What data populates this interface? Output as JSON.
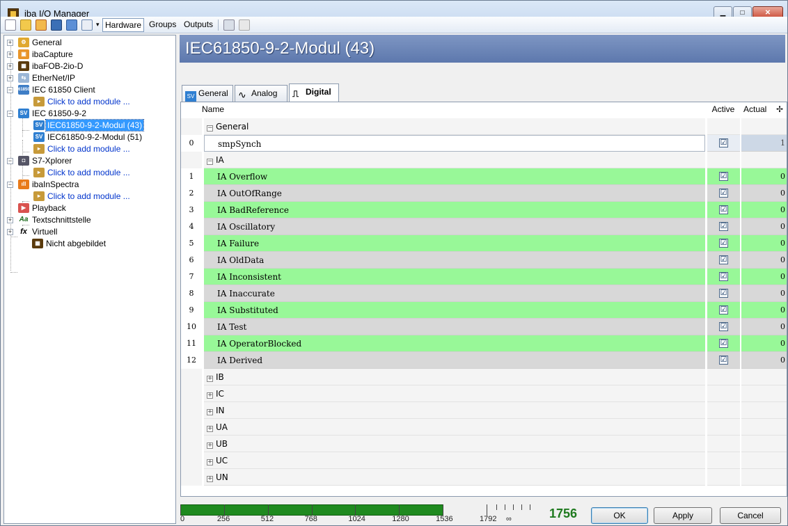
{
  "window": {
    "title": "iba I/O Manager"
  },
  "toolbar": {
    "hardware": "Hardware",
    "groups": "Groups",
    "outputs": "Outputs"
  },
  "tree": [
    {
      "label": "General",
      "icon": "gear-icon",
      "link": false
    },
    {
      "label": "ibaCapture",
      "icon": "capture-icon",
      "link": false
    },
    {
      "label": "ibaFOB-2io-D",
      "icon": "board-icon",
      "link": false
    },
    {
      "label": "EtherNet/IP",
      "icon": "network-icon",
      "link": false
    },
    {
      "label": "IEC 61850 Client",
      "icon": "iec61850-icon",
      "link": false
    },
    {
      "label": "Click to add module ...",
      "icon": "add-module-icon",
      "link": true
    },
    {
      "label": "IEC 61850-9-2",
      "icon": "sv-icon",
      "link": false
    },
    {
      "label": "IEC61850-9-2-Modul (43)",
      "icon": "sv-icon",
      "link": false,
      "selected": true
    },
    {
      "label": "IEC61850-9-2-Modul (51)",
      "icon": "sv-icon",
      "link": false
    },
    {
      "label": "Click to add module ...",
      "icon": "add-module-icon",
      "link": true
    },
    {
      "label": "S7-Xplorer",
      "icon": "s7-icon",
      "link": false
    },
    {
      "label": "Click to add module ...",
      "icon": "add-module-icon",
      "link": true
    },
    {
      "label": "ibaInSpectra",
      "icon": "spectra-icon",
      "link": false
    },
    {
      "label": "Click to add module ...",
      "icon": "add-module-icon",
      "link": true
    },
    {
      "label": "Playback",
      "icon": "playback-icon",
      "link": false
    },
    {
      "label": "Textschnittstelle",
      "icon": "text-interface-icon",
      "link": false
    },
    {
      "label": "Virtuell",
      "icon": "fx-icon",
      "link": false
    },
    {
      "label": "Nicht abgebildet",
      "icon": "board-icon",
      "link": false
    }
  ],
  "module": {
    "title": "IEC61850-9-2-Modul (43)",
    "tabs": [
      "General",
      "Analog",
      "Digital"
    ],
    "sv_badge": "SV"
  },
  "grid": {
    "headers": {
      "name": "Name",
      "active": "Active",
      "actual": "Actual"
    },
    "group_general": "General",
    "rows_general": [
      {
        "num": "0",
        "name": "smpSynch",
        "active": "☑",
        "actual": "1"
      }
    ],
    "group_ia": "IA",
    "rows_ia": [
      {
        "num": "1",
        "name": "IA Overflow",
        "active": "☑",
        "actual": "0"
      },
      {
        "num": "2",
        "name": "IA OutOfRange",
        "active": "☑",
        "actual": "0"
      },
      {
        "num": "3",
        "name": "IA BadReference",
        "active": "☑",
        "actual": "0"
      },
      {
        "num": "4",
        "name": "IA Oscillatory",
        "active": "☑",
        "actual": "0"
      },
      {
        "num": "5",
        "name": "IA Failure",
        "active": "☑",
        "actual": "0"
      },
      {
        "num": "6",
        "name": "IA OldData",
        "active": "☑",
        "actual": "0"
      },
      {
        "num": "7",
        "name": "IA Inconsistent",
        "active": "☑",
        "actual": "0"
      },
      {
        "num": "8",
        "name": "IA Inaccurate",
        "active": "☑",
        "actual": "0"
      },
      {
        "num": "9",
        "name": "IA Substituted",
        "active": "☑",
        "actual": "0"
      },
      {
        "num": "10",
        "name": "IA Test",
        "active": "☑",
        "actual": "0"
      },
      {
        "num": "11",
        "name": "IA OperatorBlocked",
        "active": "☑",
        "actual": "0"
      },
      {
        "num": "12",
        "name": "IA Derived",
        "active": "☑",
        "actual": "0"
      }
    ],
    "collapsed_groups": [
      "IB",
      "IC",
      "IN",
      "UA",
      "UB",
      "UC",
      "UN"
    ]
  },
  "footer": {
    "scale": [
      "0",
      "256",
      "512",
      "768",
      "1024",
      "1280",
      "1536",
      "1792",
      "∞"
    ],
    "value": "1756",
    "fill_fraction": 0.86,
    "ok": "OK",
    "apply": "Apply",
    "cancel": "Cancel"
  },
  "colors": {
    "active_row": "#98f898",
    "inactive_row": "#d8d8d8",
    "header": "#6b84b8"
  }
}
